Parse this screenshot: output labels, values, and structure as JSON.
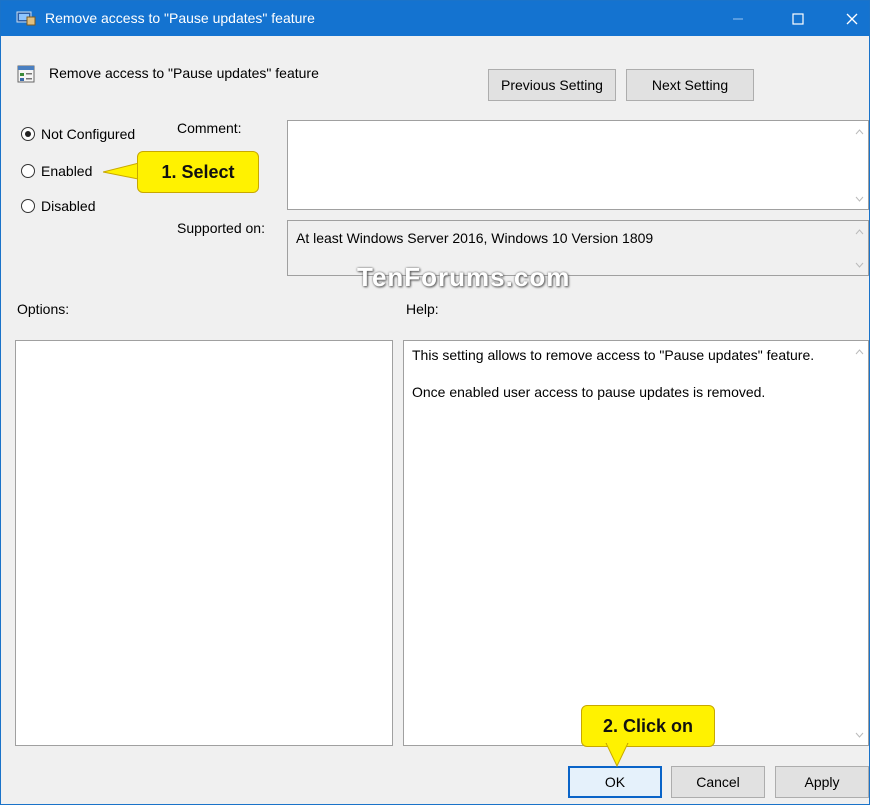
{
  "window": {
    "title": "Remove access to \"Pause updates\" feature",
    "controls": {
      "minimize": "–",
      "maximize": "□",
      "close": "✕"
    }
  },
  "header": {
    "setting_name": "Remove access to \"Pause updates\" feature",
    "previous_button": "Previous Setting",
    "next_button": "Next Setting"
  },
  "state": {
    "options": [
      {
        "label": "Not Configured",
        "checked": true
      },
      {
        "label": "Enabled",
        "checked": false
      },
      {
        "label": "Disabled",
        "checked": false
      }
    ]
  },
  "comment": {
    "label": "Comment:",
    "value": ""
  },
  "supported": {
    "label": "Supported on:",
    "value": "At least Windows Server 2016, Windows 10 Version 1809"
  },
  "sections": {
    "options_label": "Options:",
    "help_label": "Help:"
  },
  "help": {
    "lines": [
      "This setting allows to remove access to \"Pause updates\" feature.",
      "Once enabled user access to pause updates is removed."
    ]
  },
  "footer": {
    "ok": "OK",
    "cancel": "Cancel",
    "apply": "Apply"
  },
  "annotations": {
    "step1": "1. Select",
    "step2": "2. Click on"
  },
  "watermark": "TenForums.com",
  "colors": {
    "titlebar": "#1473d0",
    "callout": "#fff200",
    "ok_border": "#0a64c8"
  },
  "icons": {
    "title": "group-policy-window-icon",
    "setting": "policy-setting-icon"
  }
}
